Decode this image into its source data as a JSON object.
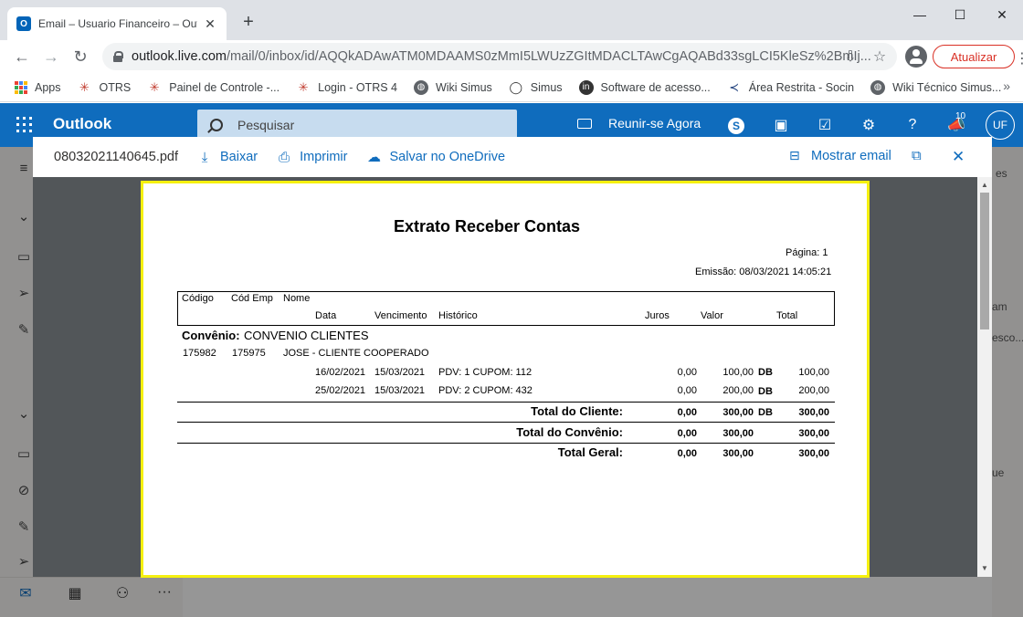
{
  "browser": {
    "tab_title": "Email – Usuario Financeiro – Outl",
    "tab_close": "✕",
    "new_tab": "+",
    "window_controls": {
      "minimize": "—",
      "maximize": "☐",
      "close": "✕"
    },
    "url_host": "outlook.live.com",
    "url_path": "/mail/0/inbox/id/AQQkADAwATM0MDAAMS0zMmI5LWUzZGItMDACLTAwCgAQABd33sgLCI5KleSz%2BmIj...",
    "update_label": "Atualizar",
    "bookmarks": [
      {
        "label": "Apps",
        "icon": "apps-grid-icon"
      },
      {
        "label": "OTRS",
        "icon": "otrs-icon"
      },
      {
        "label": "Painel de Controle -...",
        "icon": "otrs-icon"
      },
      {
        "label": "Login - OTRS 4",
        "icon": "otrs-icon"
      },
      {
        "label": "Wiki Simus",
        "icon": "globe-icon"
      },
      {
        "label": "Simus",
        "icon": "simus-icon"
      },
      {
        "label": "Software de acesso...",
        "icon": "linkedin-icon"
      },
      {
        "label": "Área Restrita - Socin",
        "icon": "socin-icon"
      },
      {
        "label": "Wiki Técnico Simus...",
        "icon": "globe-icon"
      }
    ]
  },
  "outlook": {
    "brand": "Outlook",
    "search_placeholder": "Pesquisar",
    "meet_now": "Reunir-se Agora",
    "notification_count": "10",
    "avatar_initials": "UF"
  },
  "viewer": {
    "file_name": "08032021140645.pdf",
    "download": "Baixar",
    "print": "Imprimir",
    "save_onedrive": "Salvar no OneDrive",
    "show_email": "Mostrar email"
  },
  "report": {
    "title": "Extrato Receber Contas",
    "page_label": "Página: 1",
    "emission": "Emissão: 08/03/2021 14:05:21",
    "headers": {
      "codigo": "Código",
      "cod_emp": "Cód Emp",
      "nome": "Nome",
      "data": "Data",
      "vencimento": "Vencimento",
      "historico": "Histórico",
      "juros": "Juros",
      "valor": "Valor",
      "total": "Total"
    },
    "convenio_label": "Convênio:",
    "convenio_name": "CONVENIO CLIENTES",
    "client": {
      "codigo": "175982",
      "cod_emp": "175975",
      "nome": "JOSE - CLIENTE COOPERADO"
    },
    "rows": [
      {
        "data": "16/02/2021",
        "vencimento": "15/03/2021",
        "historico": "PDV: 1 CUPOM: 112",
        "juros": "0,00",
        "valor": "100,00",
        "flag": "DB",
        "total": "100,00"
      },
      {
        "data": "25/02/2021",
        "vencimento": "15/03/2021",
        "historico": "PDV: 2 CUPOM: 432",
        "juros": "0,00",
        "valor": "200,00",
        "flag": "DB",
        "total": "200,00"
      }
    ],
    "total_cliente": {
      "label": "Total do Cliente:",
      "juros": "0,00",
      "valor": "300,00",
      "flag": "DB",
      "total": "300,00"
    },
    "total_convenio": {
      "label": "Total do Convênio:",
      "juros": "0,00",
      "valor": "300,00",
      "total": "300,00"
    },
    "total_geral": {
      "label": "Total Geral:",
      "juros": "0,00",
      "valor": "300,00",
      "total": "300,00"
    }
  },
  "background": {
    "peek_texts": [
      "es",
      "am",
      "esco...",
      "ue"
    ]
  }
}
